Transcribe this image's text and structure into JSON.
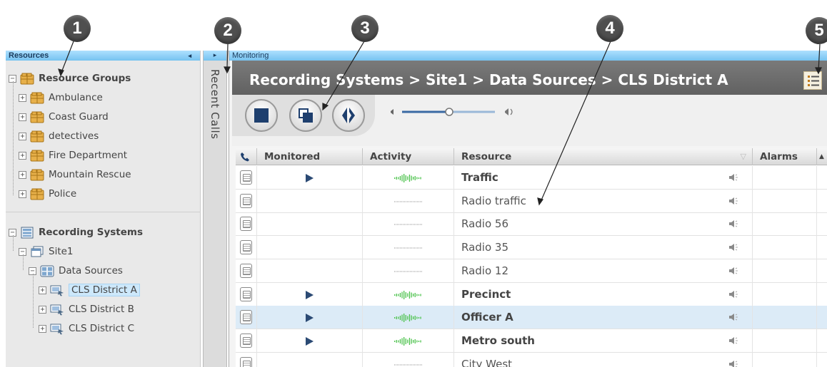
{
  "callouts": [
    "1",
    "2",
    "3",
    "4",
    "5"
  ],
  "resources_panel": {
    "title": "Resources",
    "collapse_arrow": "◂",
    "resource_groups": {
      "label": "Resource Groups",
      "items": [
        "Ambulance",
        "Coast Guard",
        "detectives",
        "Fire Department",
        "Mountain Rescue",
        "Police"
      ]
    },
    "recording_systems": {
      "label": "Recording Systems",
      "site": "Site1",
      "data_sources": "Data Sources",
      "items": [
        "CLS District A",
        "CLS District B",
        "CLS District C"
      ],
      "selected": "CLS District A"
    }
  },
  "recent_calls": {
    "expand_arrow": "▸",
    "label": "Recent Calls"
  },
  "monitoring": {
    "title": "Monitoring",
    "breadcrumb": "Recording Systems > Site1 > Data Sources > CLS District A",
    "toolbar": {
      "buttons": [
        "stop-icon",
        "split-icon",
        "audio-route-icon"
      ],
      "volume_level": 0.5
    },
    "grid": {
      "columns": [
        "Monitored",
        "Activity",
        "Resource",
        "Alarms"
      ],
      "rows": [
        {
          "resource": "Traffic",
          "monitored": true,
          "active": true
        },
        {
          "resource": "Radio traffic",
          "monitored": false,
          "active": false
        },
        {
          "resource": "Radio 56",
          "monitored": false,
          "active": false
        },
        {
          "resource": "Radio 35",
          "monitored": false,
          "active": false
        },
        {
          "resource": "Radio 12",
          "monitored": false,
          "active": false
        },
        {
          "resource": "Precinct",
          "monitored": true,
          "active": true
        },
        {
          "resource": "Officer A",
          "monitored": true,
          "active": true,
          "selected": true
        },
        {
          "resource": "Metro south",
          "monitored": true,
          "active": true
        },
        {
          "resource": "City West",
          "monitored": false,
          "active": false
        }
      ]
    }
  },
  "colors": {
    "panel_header": "#8fd0f5",
    "breadcrumb_bar": "#666666",
    "selected_row": "#dcebf7",
    "activity_wave": "#4bc24b",
    "play_icon": "#2b4a74"
  }
}
